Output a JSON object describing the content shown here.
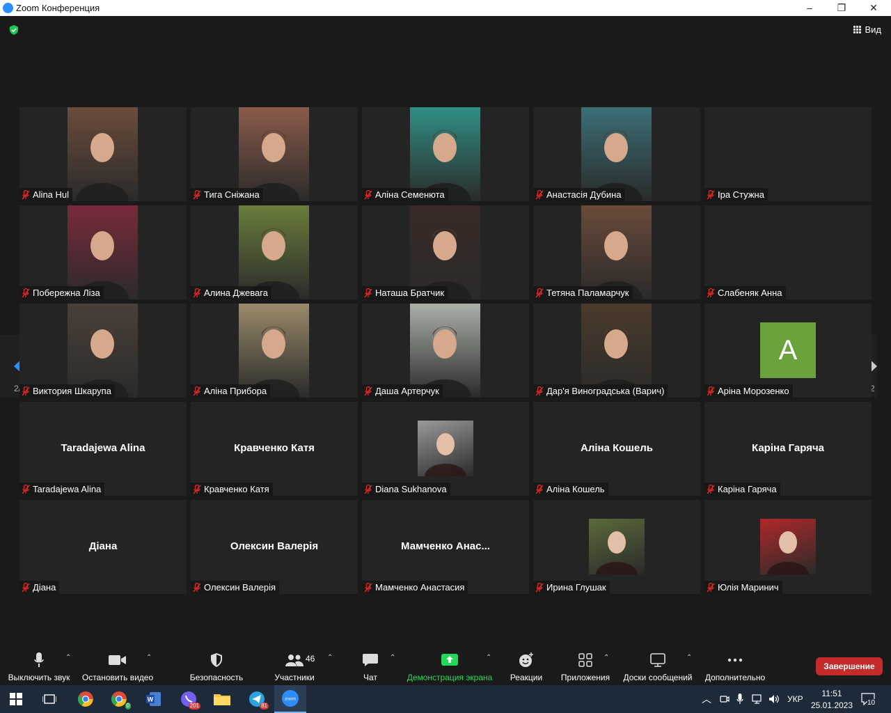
{
  "window": {
    "title": "Zoom Конференция",
    "minimize": "–",
    "maximize": "❐",
    "close": "✕"
  },
  "view": {
    "label": "Вид"
  },
  "pagination": {
    "left": "2/2",
    "right": "2/2"
  },
  "tiles": [
    {
      "name": "Alina Hul",
      "kind": "video",
      "bg": "#6b4c3b"
    },
    {
      "name": "Тига Сніжана",
      "kind": "video",
      "bg": "#8a5b4a"
    },
    {
      "name": "Аліна Семенюта",
      "kind": "video",
      "bg": "#2f8f84"
    },
    {
      "name": "Анастасія Дубина",
      "kind": "video",
      "bg": "#3b6f77"
    },
    {
      "name": "Іра Стужна",
      "kind": "blank"
    },
    {
      "name": "Побережна Ліза",
      "kind": "video",
      "bg": "#7a2a3a"
    },
    {
      "name": "Алина Джевага",
      "kind": "video",
      "bg": "#6a7d3c"
    },
    {
      "name": "Наташа Братчик",
      "kind": "video",
      "bg": "#3a2a25"
    },
    {
      "name": "Тетяна Паламарчук",
      "kind": "video",
      "bg": "#6a4a3a"
    },
    {
      "name": "Слабеняк Анна",
      "kind": "blank"
    },
    {
      "name": "Виктория Шкарупа",
      "kind": "video",
      "bg": "#4a4038"
    },
    {
      "name": "Аліна Прибора",
      "kind": "video",
      "bg": "#9a8a6a"
    },
    {
      "name": "Даша Артерчук",
      "kind": "video",
      "bg": "#aab0a8"
    },
    {
      "name": "Дар'я Виноградська (Варич)",
      "kind": "video",
      "bg": "#4a3a2a"
    },
    {
      "name": "Аріна Морозенко",
      "kind": "letter",
      "letter": "A"
    },
    {
      "name": "Taradajewa Alina",
      "kind": "text",
      "display": "Taradajewa Alina"
    },
    {
      "name": "Кравченко Катя",
      "kind": "text",
      "display": "Кравченко Катя"
    },
    {
      "name": "Diana Sukhanova",
      "kind": "photo",
      "bg": "#9a9a9a"
    },
    {
      "name": "Аліна Кошель",
      "kind": "text",
      "display": "Аліна Кошель"
    },
    {
      "name": "Каріна Гаряча",
      "kind": "text",
      "display": "Каріна Гаряча"
    },
    {
      "name": "Діана",
      "kind": "text",
      "display": "Діана"
    },
    {
      "name": "Олексин Валерія",
      "kind": "text",
      "display": "Олексин Валерія"
    },
    {
      "name": "Мамченко Анастасия",
      "kind": "text",
      "display": "Мамченко Анас..."
    },
    {
      "name": "Ирина Глушак",
      "kind": "photo",
      "bg": "#5a6a3a"
    },
    {
      "name": "Юлія Маринич",
      "kind": "photo",
      "bg": "#b0282a"
    }
  ],
  "toolbar": {
    "mute": "Выключить звук",
    "video": "Остановить видео",
    "security": "Безопасность",
    "participants": "Участники",
    "participants_count": "46",
    "chat": "Чат",
    "share": "Демонстрация экрана",
    "reactions": "Реакции",
    "apps": "Приложения",
    "whiteboards": "Доски сообщений",
    "more": "Дополнительно",
    "end": "Завершение"
  },
  "taskbar": {
    "apps": [
      {
        "icon": "windows-start-icon"
      },
      {
        "icon": "task-view-icon"
      },
      {
        "icon": "chrome-icon"
      },
      {
        "icon": "chrome-profile-icon",
        "badge": "0"
      },
      {
        "icon": "word-icon"
      },
      {
        "icon": "viber-icon",
        "badge": "201"
      },
      {
        "icon": "file-explorer-icon"
      },
      {
        "icon": "telegram-icon",
        "badge": "81"
      },
      {
        "icon": "zoom-icon",
        "label": "zoom"
      }
    ],
    "lang": "УКР",
    "time": "11:51",
    "date": "25.01.2023",
    "notifications": "10"
  },
  "colors": {
    "accent": "#2d8cff",
    "end": "#c42b2b",
    "share": "#23d959",
    "muted": "#e02828"
  }
}
